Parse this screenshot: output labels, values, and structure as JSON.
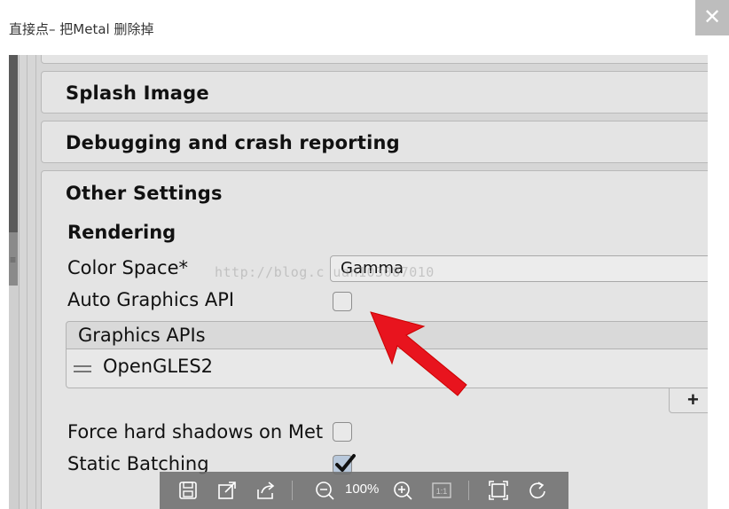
{
  "viewer": {
    "title": "直接点– 把Metal 删除掉",
    "close_glyph": "✕",
    "watermark": "http://blog.c      uan103087010",
    "zoom_level": "100%"
  },
  "inspector": {
    "sections": [
      "Splash Image",
      "Debugging and crash reporting",
      "Other Settings"
    ],
    "rendering_header": "Rendering",
    "color_space_label": "Color Space*",
    "color_space_value": "Gamma",
    "auto_graphics_api_label": "Auto Graphics API",
    "auto_graphics_api_checked": false,
    "graphics_apis_header": "Graphics APIs",
    "graphics_apis": [
      "OpenGLES2"
    ],
    "add_button_label": "+",
    "force_hard_shadows_label": "Force hard shadows on Met",
    "force_hard_shadows_checked": false,
    "static_batching_label": "Static Batching",
    "static_batching_checked": true
  },
  "toolbar_icons": [
    "save-icon",
    "open-external-icon",
    "share-icon",
    "zoom-out-icon",
    "zoom-in-icon",
    "actual-size-icon",
    "fit-screen-icon",
    "rotate-icon"
  ],
  "colors": {
    "arrow": "#e8141e",
    "panel_bg": "#e4e4e4",
    "toolbar_bg": "#6e6e6e"
  }
}
